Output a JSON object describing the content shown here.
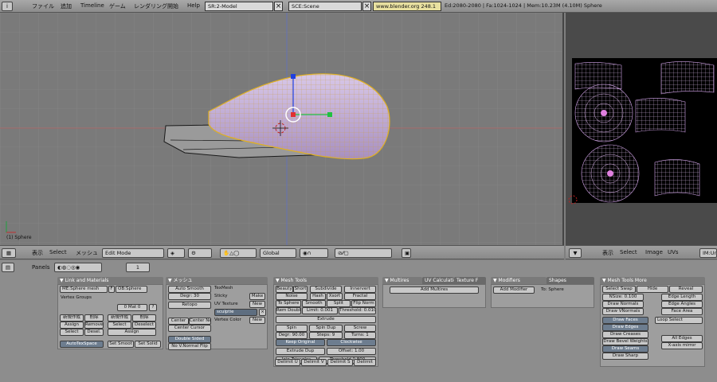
{
  "menubar": {
    "items": [
      "ファイル",
      "追加",
      "Timeline",
      "ゲーム",
      "レンダリング開始",
      "Help"
    ],
    "screen": "SR:2-Model",
    "scene": "SCE:Scene",
    "url": "www.blender.org 248.1",
    "stats": "Ed:2080-2080 | Fa:1024-1024 | Mem:10.23M (4.10M) Sphere"
  },
  "viewport": {
    "object_label": "(1) Sphere"
  },
  "view3d_header": {
    "view": "表示",
    "select": "Select",
    "mesh": "メッシュ",
    "mode": "Edit Mode",
    "orientation": "Global"
  },
  "uv_header": {
    "view": "表示",
    "select": "Select",
    "image": "Image",
    "uvs": "UVs",
    "image_name": "IM:Un"
  },
  "panels_header": {
    "label": "Panels",
    "page": "1"
  },
  "link_materials": {
    "title": "Link and Materials",
    "me": "ME:Sphere mesh",
    "f": "F",
    "ob": "OB:Sphere",
    "vertex_groups": "Vertex Groups",
    "mat": "0 Mat 0",
    "q": "?",
    "vg_buttons": [
      "新規作成",
      "削除",
      "Assign",
      "Remove",
      "Select",
      "Desel."
    ],
    "mat_buttons": [
      "新規作成",
      "削除",
      "Select",
      "Deselect",
      "Assign"
    ],
    "autotex": "AutoTexSpace",
    "set_smooth": "Set Smoot",
    "set_solid": "Set Solid"
  },
  "mesh": {
    "title": "メッシュ",
    "auto_smooth": "Auto Smooth",
    "degr": "Degr: 30",
    "retopo": "Retopo",
    "texmesh": "TexMesh",
    "sticky": "Sticky",
    "make": "Make",
    "uv_texture": "UV Texture",
    "new": "New",
    "sculptie": "sculptie",
    "vertex_color": "Vertex Color",
    "new2": "New",
    "center_new": "Center New",
    "center_cursor": "Center Cursor",
    "center": "Center",
    "double_sided": "Double Sided",
    "no_v_normal": "No V.Normal Flip"
  },
  "mesh_tools": {
    "title": "Mesh Tools",
    "row1": [
      "Beauty",
      "Short",
      "Subdivide",
      "Innervert"
    ],
    "row2": [
      "Noise",
      "Hash",
      "Xsort",
      "Fractal"
    ],
    "row3": [
      "To Sphere",
      "Smooth",
      "Split",
      "Flip Norm"
    ],
    "row4": [
      "Rem Doubl",
      "Limit: 0.001",
      "Threshold: 0.010"
    ],
    "extrude": "Extrude",
    "spin": "Spin",
    "spin_dup": "Spin Dup",
    "screw": "Screw",
    "degr": "Degr: 90.00",
    "steps": "Steps: 9",
    "turns": "Turns: 1",
    "keep_original": "Keep Original",
    "clockwise": "Clockwise",
    "extrude_dup": "Extrude Dup",
    "offset": "Offset: 1.00",
    "join_triangles": "Join Triangles",
    "threshold": "Threshold 0.800",
    "delimit": [
      "Delimit U",
      "Delimit V",
      "Delimit S",
      "Delimit"
    ]
  },
  "multires": {
    "tab1": "Multires",
    "tab2": "UV Calculation",
    "tab3": "Texture F",
    "add": "Add Multires"
  },
  "modifiers": {
    "tab1": "Modifiers",
    "tab2": "Shapes",
    "add": "Add Modifier",
    "to": "To: Sphere"
  },
  "mesh_tools_more": {
    "title": "Mesh Tools More",
    "select_swap": "Select Swap",
    "hide": "Hide",
    "reveal": "Reveal",
    "nsize": "NSize: 0.100",
    "edge_length": "Edge Length",
    "draw_normals": "Draw Normals",
    "edge_angles": "Edge Angles",
    "draw_vnormals": "Draw VNormals",
    "face_area": "Face Area",
    "draw_faces": "Draw Faces",
    "draw_edges": "Draw Edges",
    "draw_creases": "Draw Creases",
    "draw_bevel": "Draw Bevel Weights",
    "draw_seams": "Draw Seams",
    "draw_sharp": "Draw Sharp",
    "loop_select": "Loop Select",
    "all_edges": "All Edges",
    "x_mirror": "X-axis mirror"
  }
}
